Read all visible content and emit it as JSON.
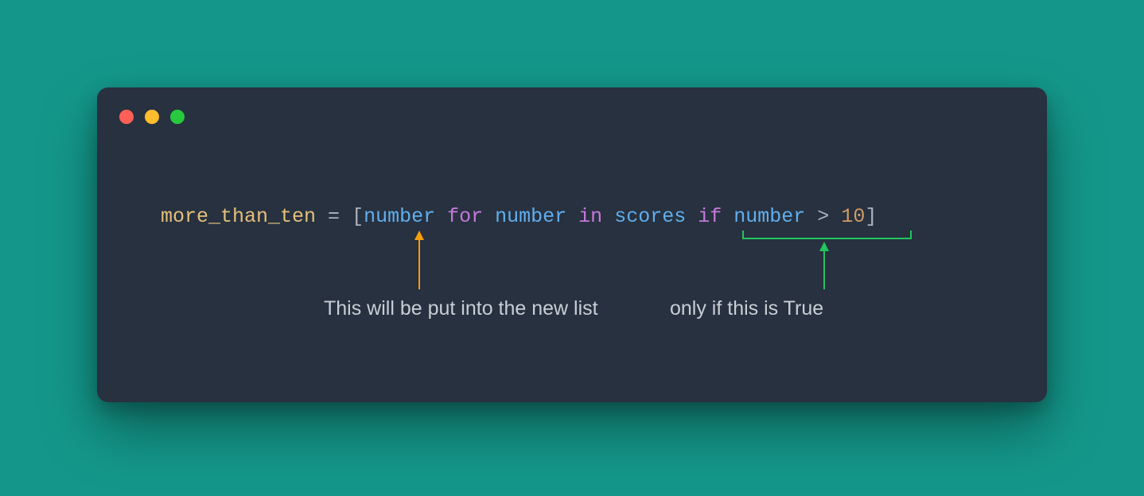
{
  "code": {
    "var": "more_than_ten",
    "eq": " = ",
    "lbr": "[",
    "expr1": "number",
    "sp1": " ",
    "kw_for": "for",
    "sp2": " ",
    "iter_var": "number",
    "sp3": " ",
    "kw_in": "in",
    "sp4": " ",
    "iterable": "scores",
    "sp5": " ",
    "kw_if": "if",
    "sp6": " ",
    "cond_var": "number",
    "sp7": " ",
    "cond_op": ">",
    "sp8": " ",
    "cond_val": "10",
    "rbr": "]"
  },
  "annotations": {
    "left": "This will be put into the new list",
    "right": "only if this is True"
  },
  "colors": {
    "bg": "#14978a",
    "window": "#27313f",
    "arrow_orange": "#f59e0b",
    "arrow_green": "#22c55e",
    "text_gray": "#c9ced6"
  }
}
